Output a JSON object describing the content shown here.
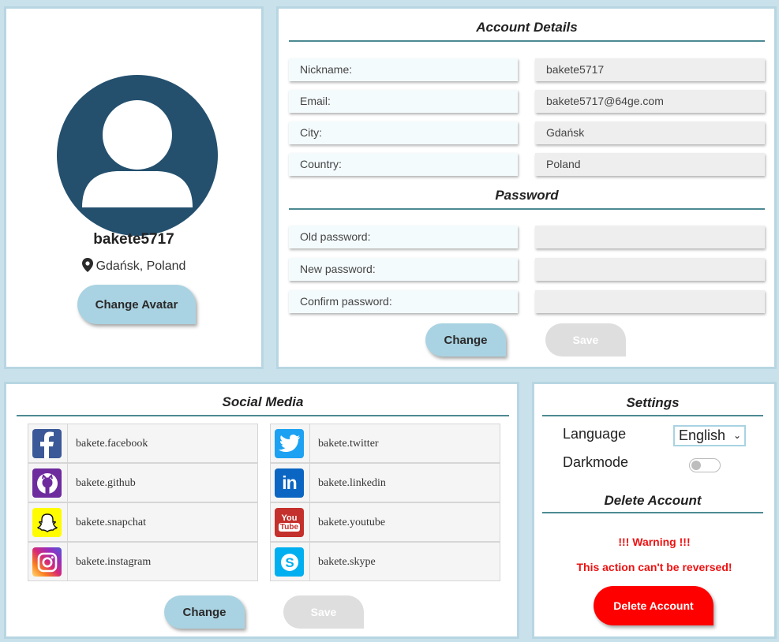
{
  "profile": {
    "username": "bakete5717",
    "location": "Gdańsk, Poland",
    "change_avatar_label": "Change Avatar"
  },
  "account": {
    "title": "Account Details",
    "fields": [
      {
        "label": "Nickname:",
        "value": "bakete5717"
      },
      {
        "label": "Email:",
        "value": "bakete5717@64ge.com"
      },
      {
        "label": "City:",
        "value": "Gdańsk"
      },
      {
        "label": "Country:",
        "value": "Poland"
      }
    ]
  },
  "password": {
    "title": "Password",
    "fields": [
      {
        "label": "Old password:",
        "value": ""
      },
      {
        "label": "New password:",
        "value": ""
      },
      {
        "label": "Confirm password:",
        "value": ""
      }
    ],
    "change_label": "Change",
    "save_label": "Save"
  },
  "social": {
    "title": "Social Media",
    "items": [
      {
        "network": "facebook",
        "icon": "facebook-icon",
        "handle": "bakete.facebook",
        "color": "#3b5998"
      },
      {
        "network": "twitter",
        "icon": "twitter-icon",
        "handle": "bakete.twitter",
        "color": "#1da1f2"
      },
      {
        "network": "github",
        "icon": "github-icon",
        "handle": "bakete.github",
        "color": "#6e2b9e"
      },
      {
        "network": "linkedin",
        "icon": "linkedin-icon",
        "handle": "bakete.linkedin",
        "color": "#0a66c2"
      },
      {
        "network": "snapchat",
        "icon": "snapchat-icon",
        "handle": "bakete.snapchat",
        "color": "#fffc00"
      },
      {
        "network": "youtube",
        "icon": "youtube-icon",
        "handle": "bakete.youtube",
        "color": "#c4302b"
      },
      {
        "network": "instagram",
        "icon": "instagram-icon",
        "handle": "bakete.instagram",
        "color": "#d62976"
      },
      {
        "network": "skype",
        "icon": "skype-icon",
        "handle": "bakete.skype",
        "color": "#00aff0"
      }
    ],
    "change_label": "Change",
    "save_label": "Save"
  },
  "settings": {
    "title": "Settings",
    "language_label": "Language",
    "language_value": "English",
    "darkmode_label": "Darkmode",
    "darkmode_on": false
  },
  "delete": {
    "title": "Delete Account",
    "warning": "!!! Warning !!!",
    "message": "This action can't be reversed!",
    "button_label": "Delete Account"
  },
  "colors": {
    "accent": "#a9d3e2",
    "avatar": "#24506e",
    "danger": "#ff0000",
    "divider": "#4d8a93"
  }
}
